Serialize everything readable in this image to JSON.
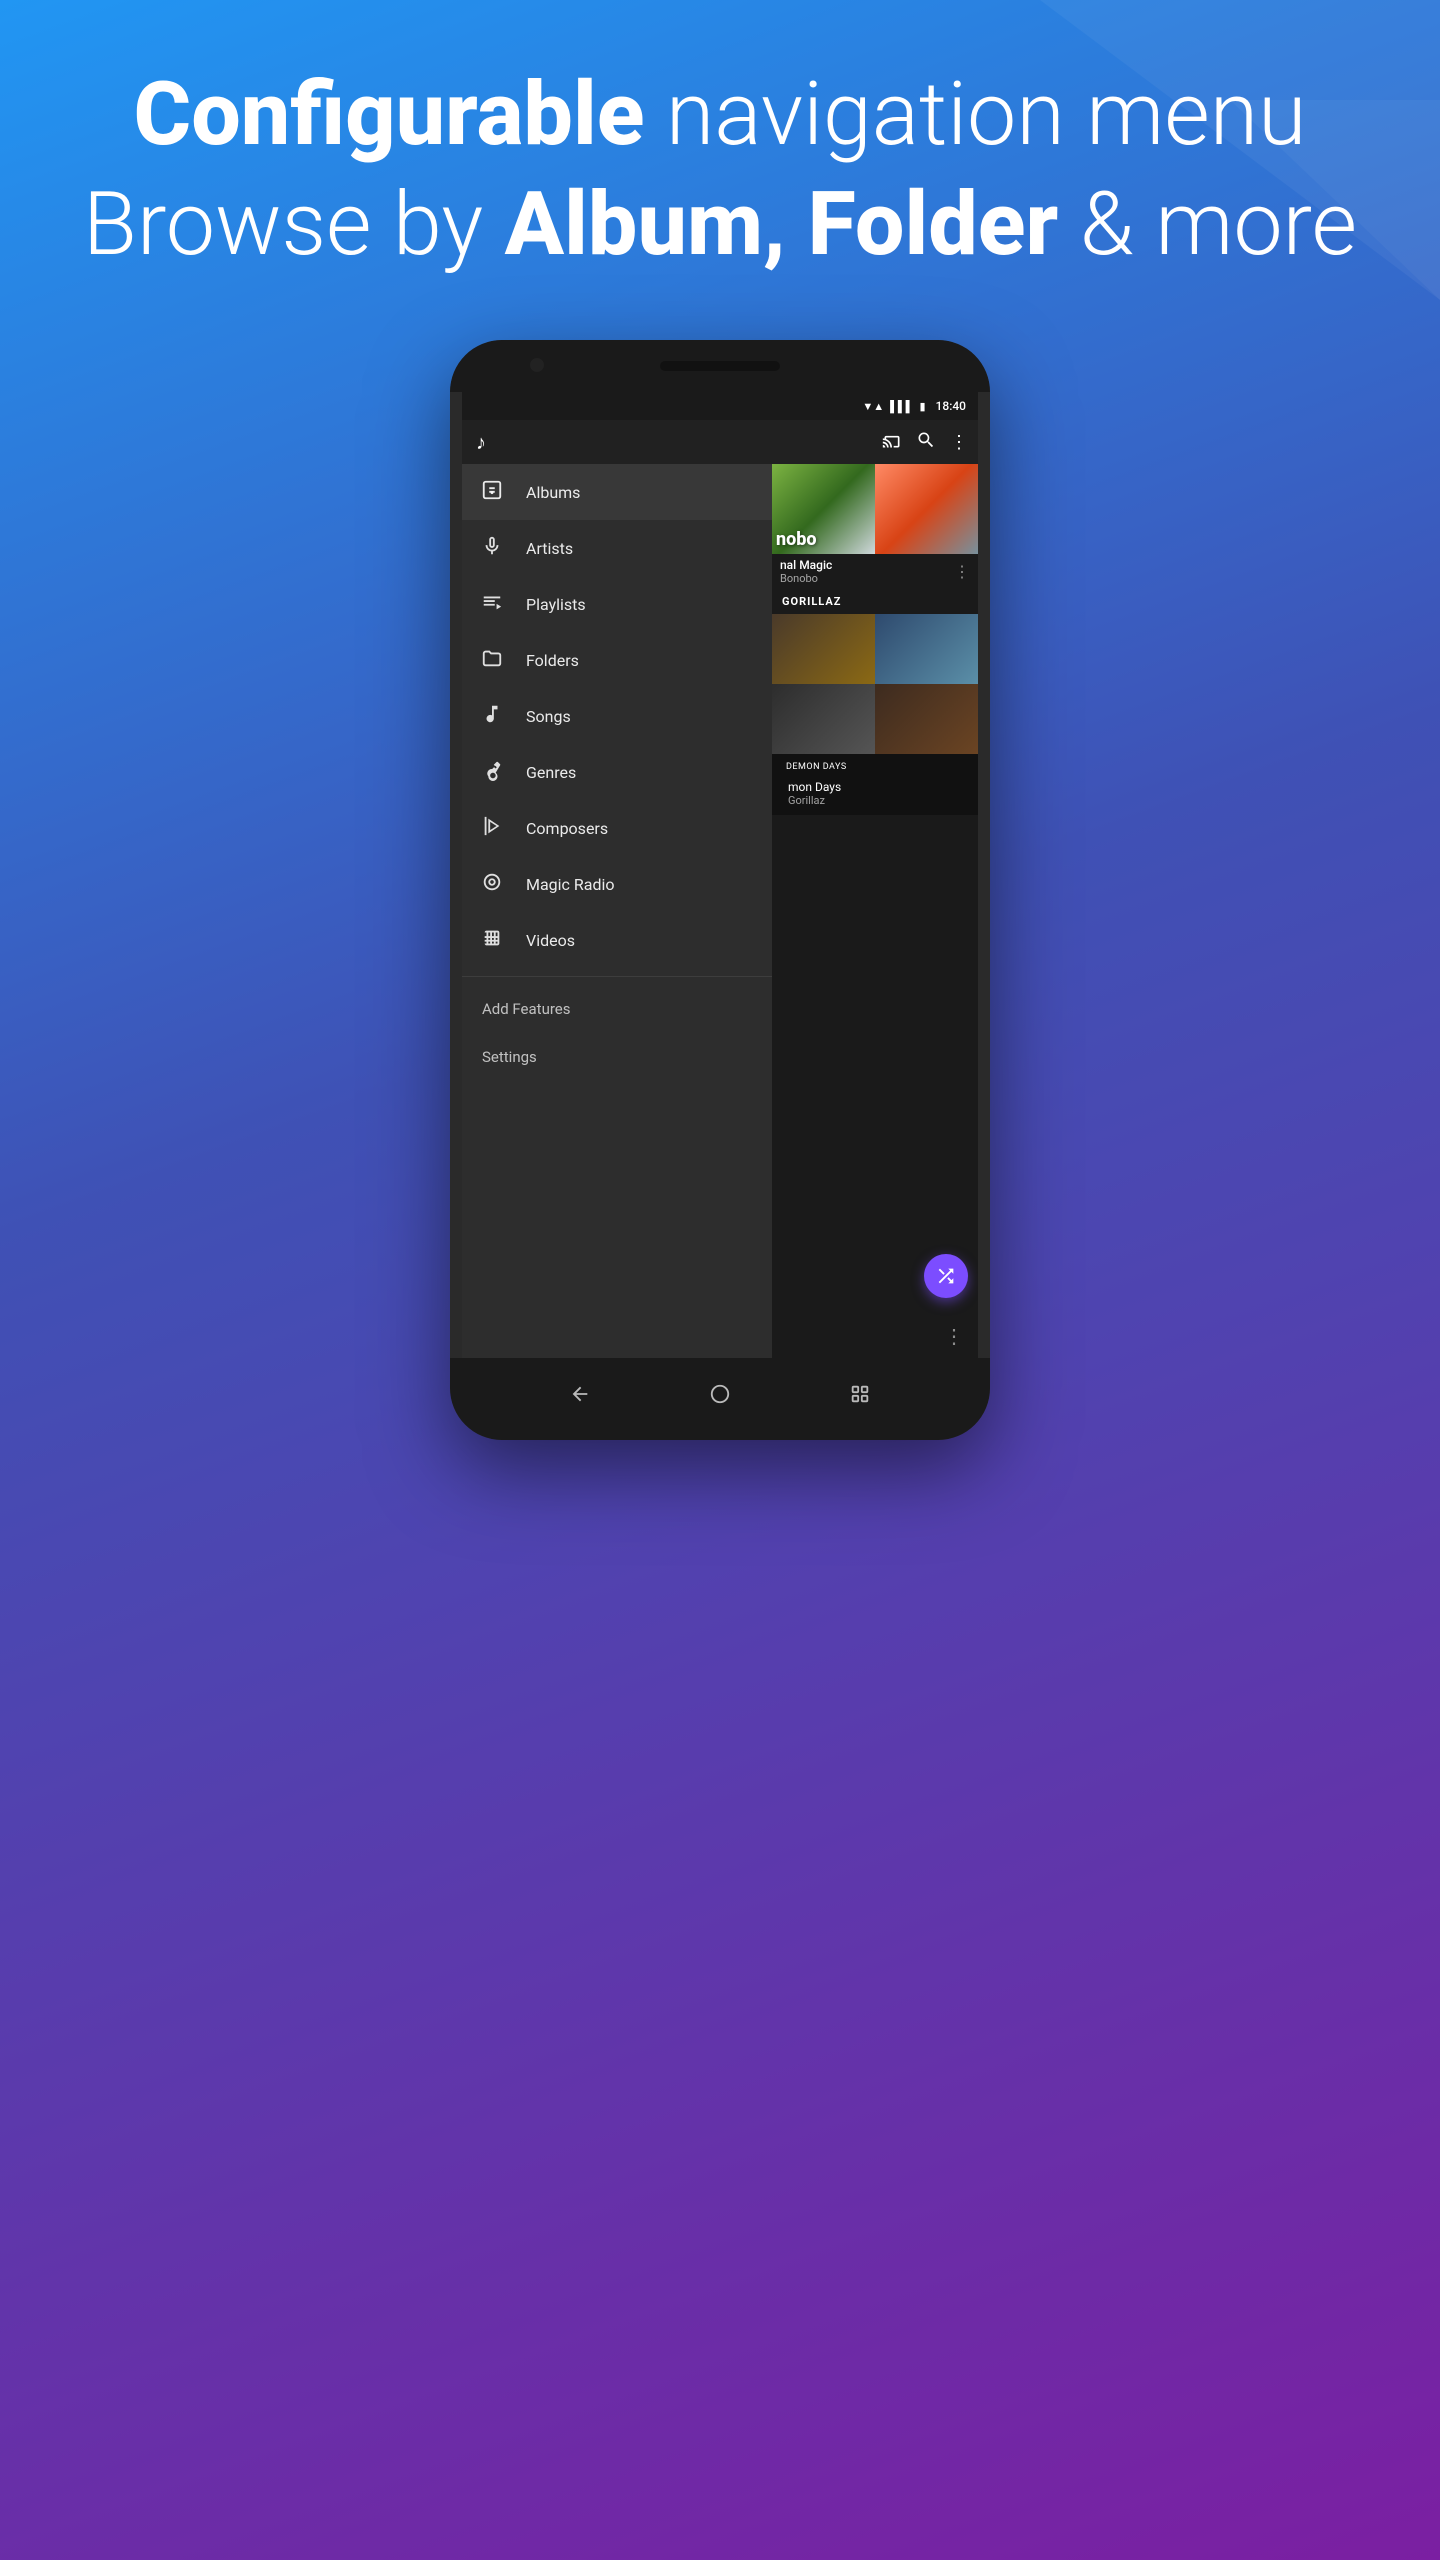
{
  "header": {
    "line1_regular": " navigation menu",
    "line1_bold": "Configurable",
    "line2_regular": "Browse by ",
    "line2_bold": "Album, Folder",
    "line2_end": " & more"
  },
  "status_bar": {
    "time": "18:40",
    "wifi": "▼▲",
    "signal": "▌▌▌",
    "battery": "▮"
  },
  "nav_drawer": {
    "items": [
      {
        "id": "albums",
        "label": "Albums",
        "active": true,
        "icon": "music-square-icon"
      },
      {
        "id": "artists",
        "label": "Artists",
        "active": false,
        "icon": "microphone-icon"
      },
      {
        "id": "playlists",
        "label": "Playlists",
        "active": false,
        "icon": "playlist-icon"
      },
      {
        "id": "folders",
        "label": "Folders",
        "active": false,
        "icon": "folder-icon"
      },
      {
        "id": "songs",
        "label": "Songs",
        "active": false,
        "icon": "music-note-icon"
      },
      {
        "id": "genres",
        "label": "Genres",
        "active": false,
        "icon": "guitar-icon"
      },
      {
        "id": "composers",
        "label": "Composers",
        "active": false,
        "icon": "harp-icon"
      },
      {
        "id": "magic-radio",
        "label": "Magic Radio",
        "active": false,
        "icon": "radio-icon"
      },
      {
        "id": "videos",
        "label": "Videos",
        "active": false,
        "icon": "film-icon"
      }
    ],
    "extra_items": [
      {
        "id": "add-features",
        "label": "Add Features"
      },
      {
        "id": "settings",
        "label": "Settings"
      }
    ]
  },
  "app_bar": {
    "cast_icon": "cast-icon",
    "search_icon": "search-icon",
    "more_icon": "more-icon"
  },
  "main_content": {
    "albums": [
      {
        "id": "nobo",
        "title": "nobo",
        "artist": "nal Magic",
        "color": "#4CAF50"
      },
      {
        "id": "bonobo",
        "title": "Animal Magic",
        "artist": "Bonobo",
        "color": "#FF9800"
      }
    ],
    "gorillaz_label": "GORILLAZ",
    "gorillaz_thumbs": 4,
    "demon_days": {
      "label": "DEMON DAYS",
      "title": "mon Days",
      "artist": "Gorillaz"
    }
  }
}
